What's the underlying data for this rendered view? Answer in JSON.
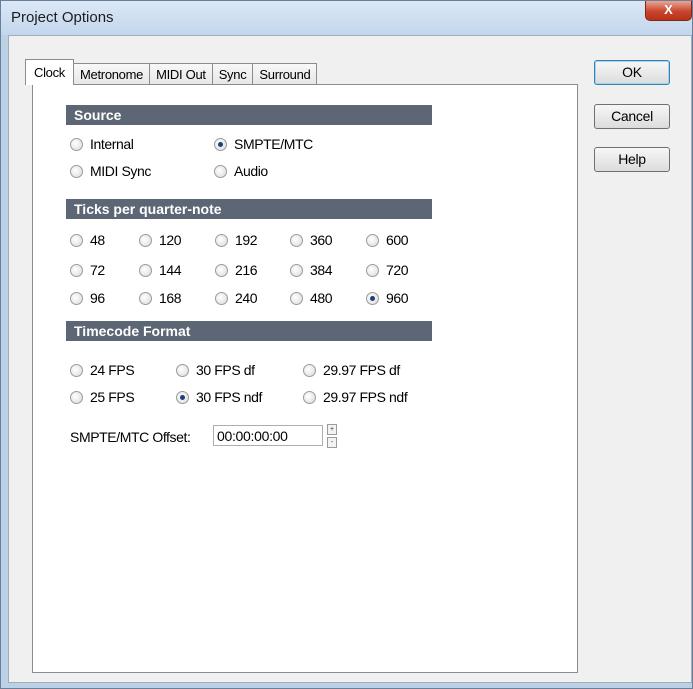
{
  "window": {
    "title": "Project Options",
    "close_glyph": "X"
  },
  "tabs": [
    {
      "label": "Clock",
      "active": true
    },
    {
      "label": "Metronome",
      "active": false
    },
    {
      "label": "MIDI Out",
      "active": false
    },
    {
      "label": "Sync",
      "active": false
    },
    {
      "label": "Surround",
      "active": false
    }
  ],
  "buttons": {
    "ok": "OK",
    "cancel": "Cancel",
    "help": "Help"
  },
  "source": {
    "header": "Source",
    "options": {
      "internal": "Internal",
      "smpte": "SMPTE/MTC",
      "midi_sync": "MIDI Sync",
      "audio": "Audio"
    },
    "selected": "SMPTE/MTC"
  },
  "ticks": {
    "header": "Ticks per quarter-note",
    "values": [
      "48",
      "120",
      "192",
      "360",
      "600",
      "72",
      "144",
      "216",
      "384",
      "720",
      "96",
      "168",
      "240",
      "480",
      "960"
    ],
    "selected": "960"
  },
  "timecode": {
    "header": "Timecode Format",
    "options": {
      "fps24": "24 FPS",
      "fps30df": "30 FPS df",
      "fps2997df": "29.97 FPS df",
      "fps25": "25 FPS",
      "fps30ndf": "30 FPS ndf",
      "fps2997ndf": "29.97 FPS ndf"
    },
    "selected": "30 FPS ndf"
  },
  "offset": {
    "label": "SMPTE/MTC Offset:",
    "value": "00:00:00:00",
    "spin_up": "+",
    "spin_down": "-"
  }
}
